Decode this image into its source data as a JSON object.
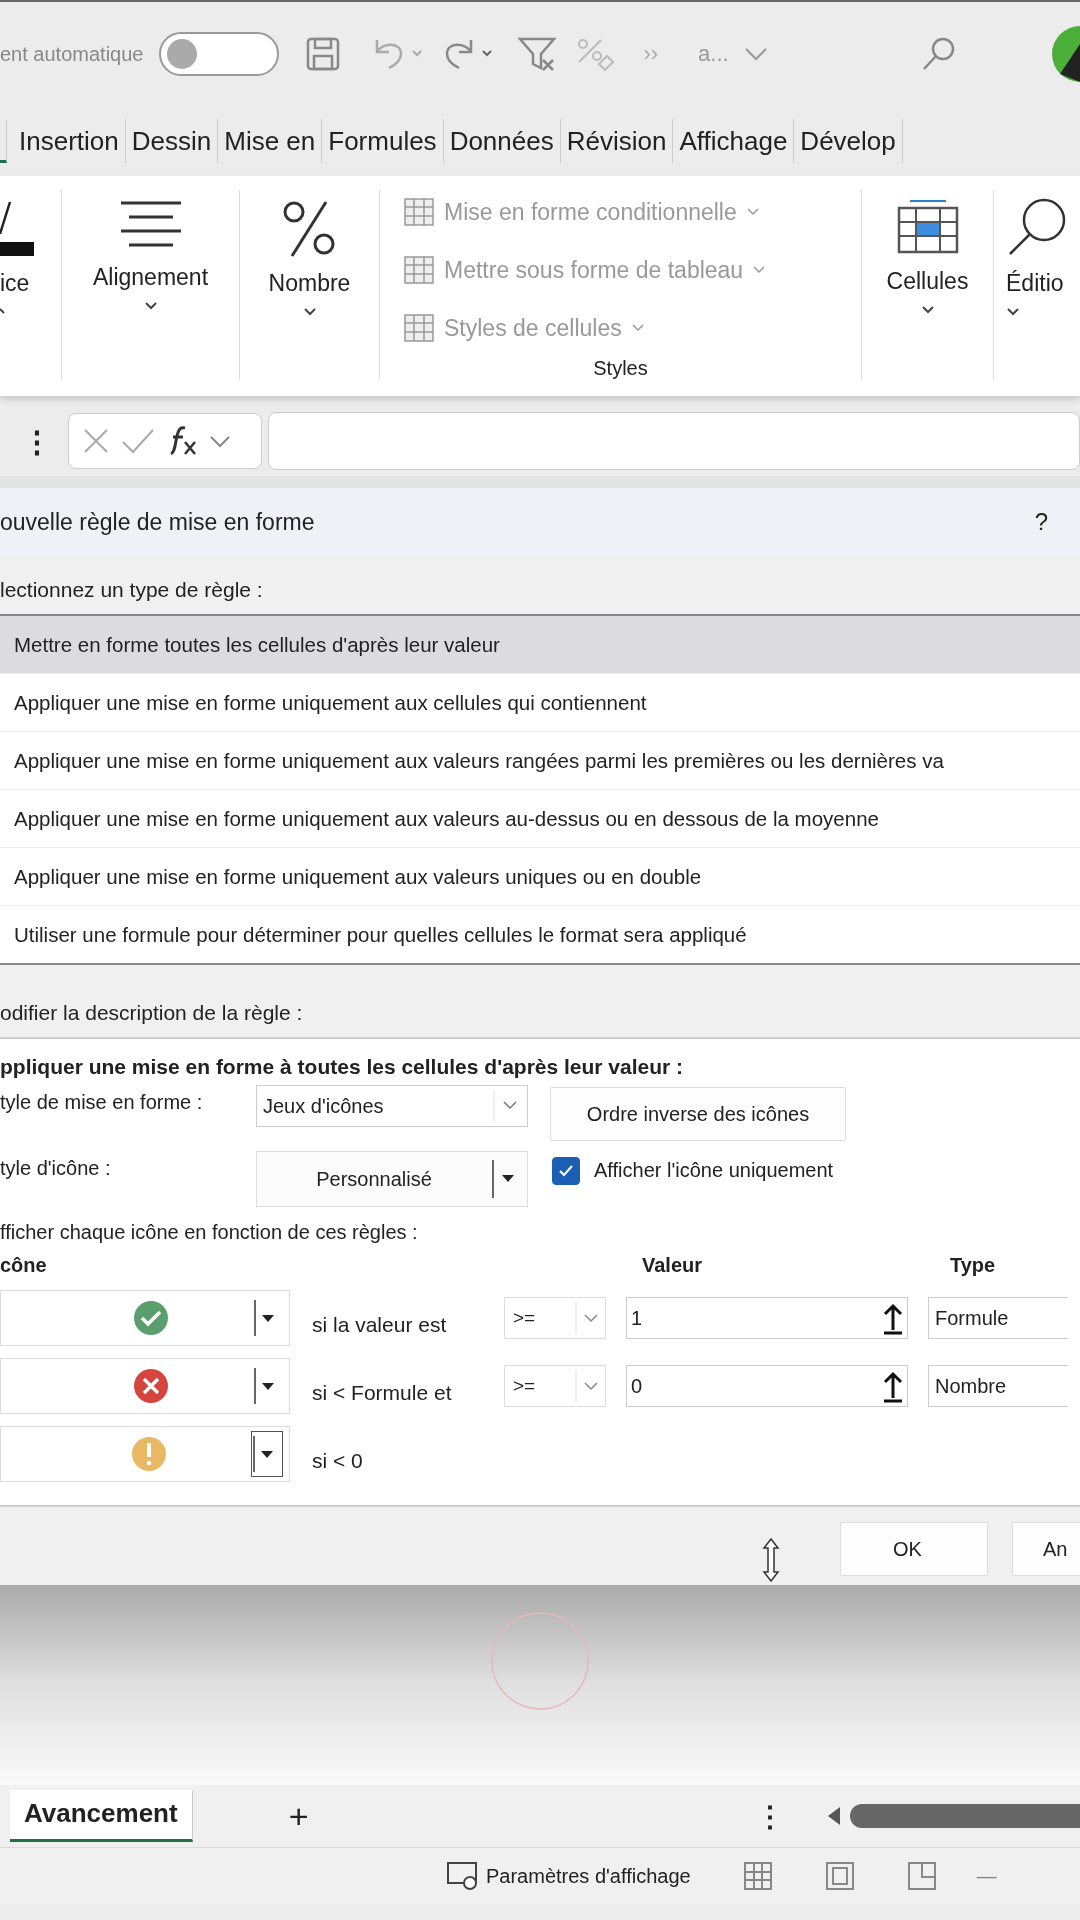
{
  "quick_access": {
    "autosave_label": "ent automatique",
    "autosave_on": false,
    "more": "››",
    "name_box": "a..."
  },
  "ribbon_tabs": [
    {
      "label": "Insertion",
      "selected": false
    },
    {
      "label": "Dessin",
      "selected": false
    },
    {
      "label": "Mise en",
      "selected": false
    },
    {
      "label": "Formules",
      "selected": false
    },
    {
      "label": "Données",
      "selected": false
    },
    {
      "label": "Révision",
      "selected": false
    },
    {
      "label": "Affichage",
      "selected": false
    },
    {
      "label": "Dévelop",
      "selected": false
    }
  ],
  "ribbon": {
    "font_group": "ice",
    "alignment": "Alignement",
    "number": "Nombre",
    "styles_items": [
      "Mise en forme conditionnelle",
      "Mettre sous forme de tableau",
      "Styles de cellules"
    ],
    "styles_label": "Styles",
    "cells": "Cellules",
    "editing": "Éditio"
  },
  "formula_bar": {
    "menu": "⋮"
  },
  "dialog": {
    "title": "ouvelle règle de mise en forme",
    "help": "?",
    "rule_type_label": "lectionnez un type de règle :",
    "rule_types": [
      {
        "label": "Mettre en forme toutes les cellules d'après leur valeur",
        "selected": true
      },
      {
        "label": "Appliquer une mise en forme uniquement aux cellules qui contiennent",
        "selected": false
      },
      {
        "label": "Appliquer une mise en forme uniquement aux valeurs rangées parmi les premières ou les dernières va",
        "selected": false
      },
      {
        "label": "Appliquer une mise en forme uniquement aux valeurs au-dessus ou en dessous de la moyenne",
        "selected": false
      },
      {
        "label": "Appliquer une mise en forme uniquement aux valeurs uniques ou en double",
        "selected": false
      },
      {
        "label": "Utiliser une formule pour déterminer pour quelles cellules le format sera appliqué",
        "selected": false
      }
    ],
    "description_label": "odifier la description de la règle :",
    "description_heading": "ppliquer une mise en forme à toutes les cellules d'après leur valeur :",
    "format_style_label": "tyle de mise en forme :",
    "format_style": "Jeux d'icônes",
    "reverse_button": "Ordre inverse des icônes",
    "icon_style_label": "tyle d'icône :",
    "icon_style": "Personnalisé",
    "show_icon_only": {
      "label": "Afficher l'icône uniquement",
      "checked": true
    },
    "rules_label": "fficher chaque icône en fonction de ces règles :",
    "columns": {
      "icon": "cône",
      "value": "Valeur",
      "type": "Type"
    },
    "rules": [
      {
        "kind": "check",
        "color": "#5a9e6e",
        "condition": "si la valeur est",
        "operator": ">=",
        "value": "1",
        "type": "Formule"
      },
      {
        "kind": "cross",
        "color": "#d6453d",
        "condition": "si < Formule et",
        "operator": ">=",
        "value": "0",
        "type": "Nombre"
      },
      {
        "kind": "exclamation",
        "color": "#e8b865",
        "condition": "si < 0"
      }
    ],
    "buttons": [
      "OK",
      "An"
    ]
  },
  "sheet_tabs": [
    {
      "label": "Avancement",
      "selected": true
    }
  ],
  "add_sheet": "+",
  "sheet_menu": "⋮",
  "status_bar": {
    "display_settings": "Paramètres d'affichage",
    "zoom_out": "—"
  }
}
